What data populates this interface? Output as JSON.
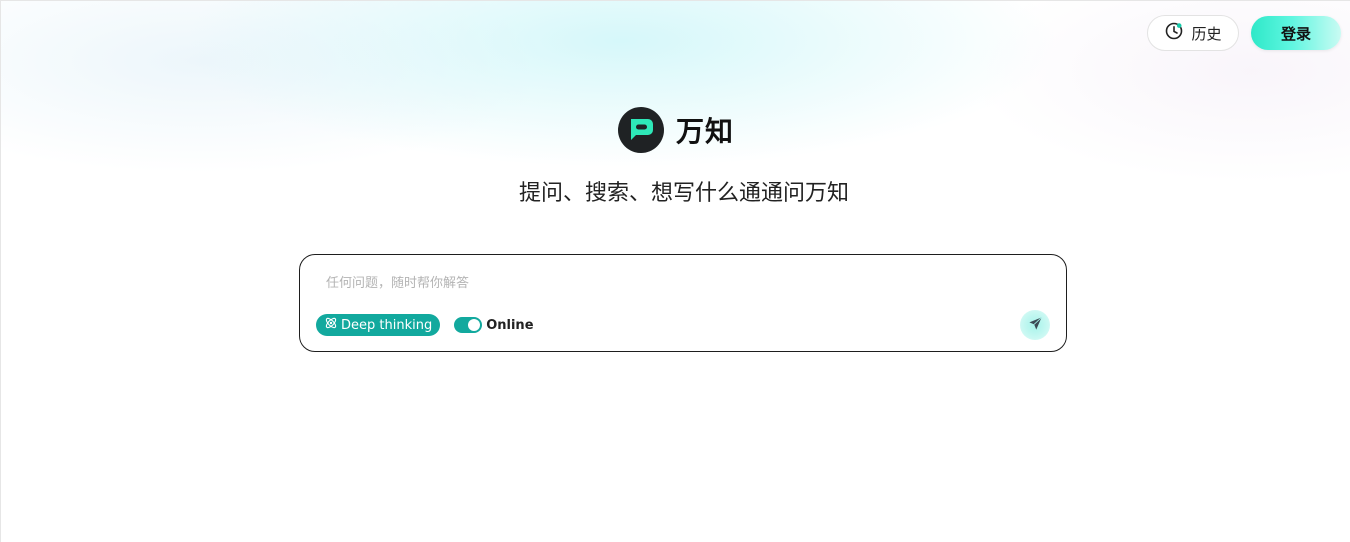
{
  "header": {
    "history_label": "历史",
    "login_label": "登录"
  },
  "brand": {
    "name": "万知",
    "tagline": "提问、搜索、想写什么通通问万知"
  },
  "chat": {
    "placeholder": "任何问题，随时帮你解答",
    "deep_thinking_label": "Deep thinking",
    "online_label": "Online",
    "online_enabled": true
  },
  "colors": {
    "accent": "#12a99e",
    "login_gradient_start": "#2ee8c8",
    "logo_bg": "#1f2224"
  },
  "icons": {
    "history": "history-clock-icon",
    "logo": "chat-bubble-logo-icon",
    "deep_thinking": "atom-icon",
    "send": "send-arrow-icon"
  }
}
